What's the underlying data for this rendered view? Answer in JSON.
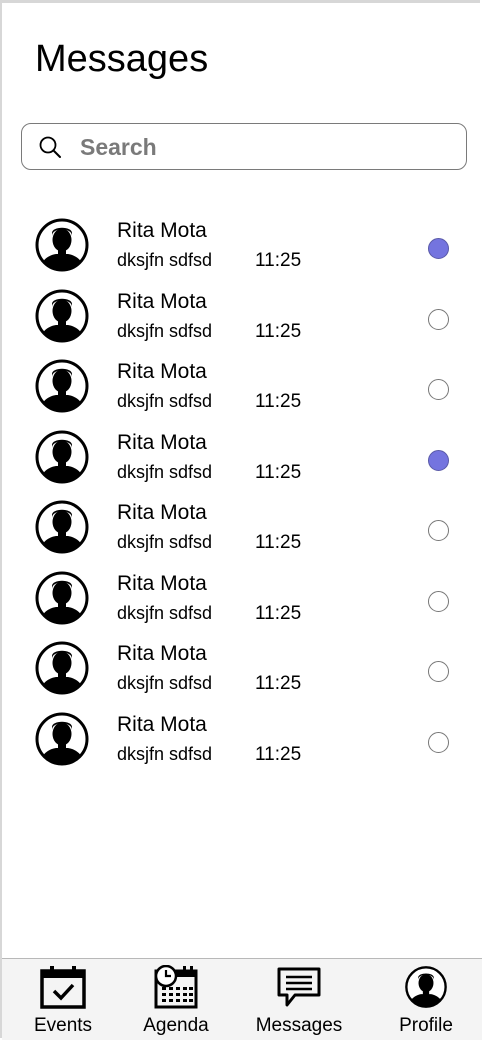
{
  "header": {
    "title": "Messages"
  },
  "search": {
    "placeholder": "Search",
    "value": ""
  },
  "messages": [
    {
      "name": "Rita Mota",
      "preview": "dksjfn sdfsd",
      "time": "11:25",
      "unread": true
    },
    {
      "name": "Rita Mota",
      "preview": "dksjfn sdfsd",
      "time": "11:25",
      "unread": false
    },
    {
      "name": "Rita Mota",
      "preview": "dksjfn sdfsd",
      "time": "11:25",
      "unread": false
    },
    {
      "name": "Rita Mota",
      "preview": "dksjfn sdfsd",
      "time": "11:25",
      "unread": true
    },
    {
      "name": "Rita Mota",
      "preview": "dksjfn sdfsd",
      "time": "11:25",
      "unread": false
    },
    {
      "name": "Rita Mota",
      "preview": "dksjfn sdfsd",
      "time": "11:25",
      "unread": false
    },
    {
      "name": "Rita Mota",
      "preview": "dksjfn sdfsd",
      "time": "11:25",
      "unread": false
    },
    {
      "name": "Rita Mota",
      "preview": "dksjfn sdfsd",
      "time": "11:25",
      "unread": false
    }
  ],
  "tabbar": {
    "tabs": [
      {
        "label": "Events",
        "icon": "calendar-check-icon"
      },
      {
        "label": "Agenda",
        "icon": "calendar-clock-icon"
      },
      {
        "label": "Messages",
        "icon": "chat-bubble-icon"
      },
      {
        "label": "Profile",
        "icon": "user-avatar-icon"
      }
    ]
  },
  "colors": {
    "unread_dot": "#7474df",
    "tabbar_bg": "#f4f4f4"
  }
}
